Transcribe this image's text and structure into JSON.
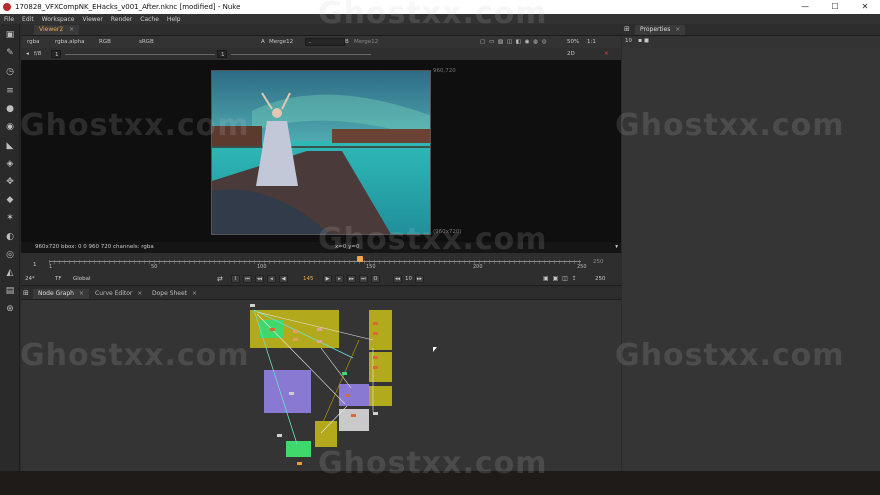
{
  "window": {
    "title": "170828_VFXCompNK_EHacks_v001_After.nknc [modified] - Nuke",
    "controls": [
      "—",
      "☐",
      "✕"
    ]
  },
  "menu": [
    "File",
    "Edit",
    "Workspace",
    "Viewer",
    "Render",
    "Cache",
    "Help"
  ],
  "toolbar": {
    "icons": [
      "image-icon",
      "paint-icon",
      "time-icon",
      "channel-icon",
      "color-icon",
      "filter-icon",
      "keyer-icon",
      "merge-icon",
      "transform-icon",
      "3d-icon",
      "particles-icon",
      "deep-icon",
      "views-icon",
      "metadata-icon",
      "toolsets-icon",
      "other-icon"
    ]
  },
  "viewer": {
    "tab": "Viewer2",
    "channels": "rgba",
    "alpha": "rgba.alpha",
    "colorspace_mode": "RGB",
    "lut": "sRGB",
    "input_a_label": "A",
    "input_a": "Merge12",
    "wipe": "-",
    "input_b_label": "B",
    "input_b": "Merge12",
    "zoom": "50%",
    "proxy": "1:1",
    "view_mode": "2D",
    "frame_field": "f/8",
    "gain": "1",
    "res_top": "960,720",
    "res_bottom": "(960x720)",
    "info_left": "960x720  bbox: 0 0 960 720 channels: rgba",
    "info_center": "x=0 y=0"
  },
  "timeline": {
    "start": "1",
    "end": "250",
    "end_field": "250",
    "ticks": [
      "1",
      "50",
      "100",
      "150",
      "200",
      "250"
    ],
    "current_frame": "145",
    "fps": "24*",
    "tf": "TF",
    "range_mode": "Global",
    "step": "10",
    "out_field": "250"
  },
  "panels": {
    "node_tabs": [
      "Node Graph",
      "Curve Editor",
      "Dope Sheet"
    ],
    "properties_tab": "Properties",
    "properties_count": "10"
  },
  "colors": {
    "accent": "#f0a84a",
    "backdrop_yellow": "#b3a91c",
    "backdrop_purple": "#8a79d3",
    "backdrop_green": "#3fd86a",
    "node_gray": "#c9c9c9"
  },
  "watermark": "Ghostxx.com"
}
